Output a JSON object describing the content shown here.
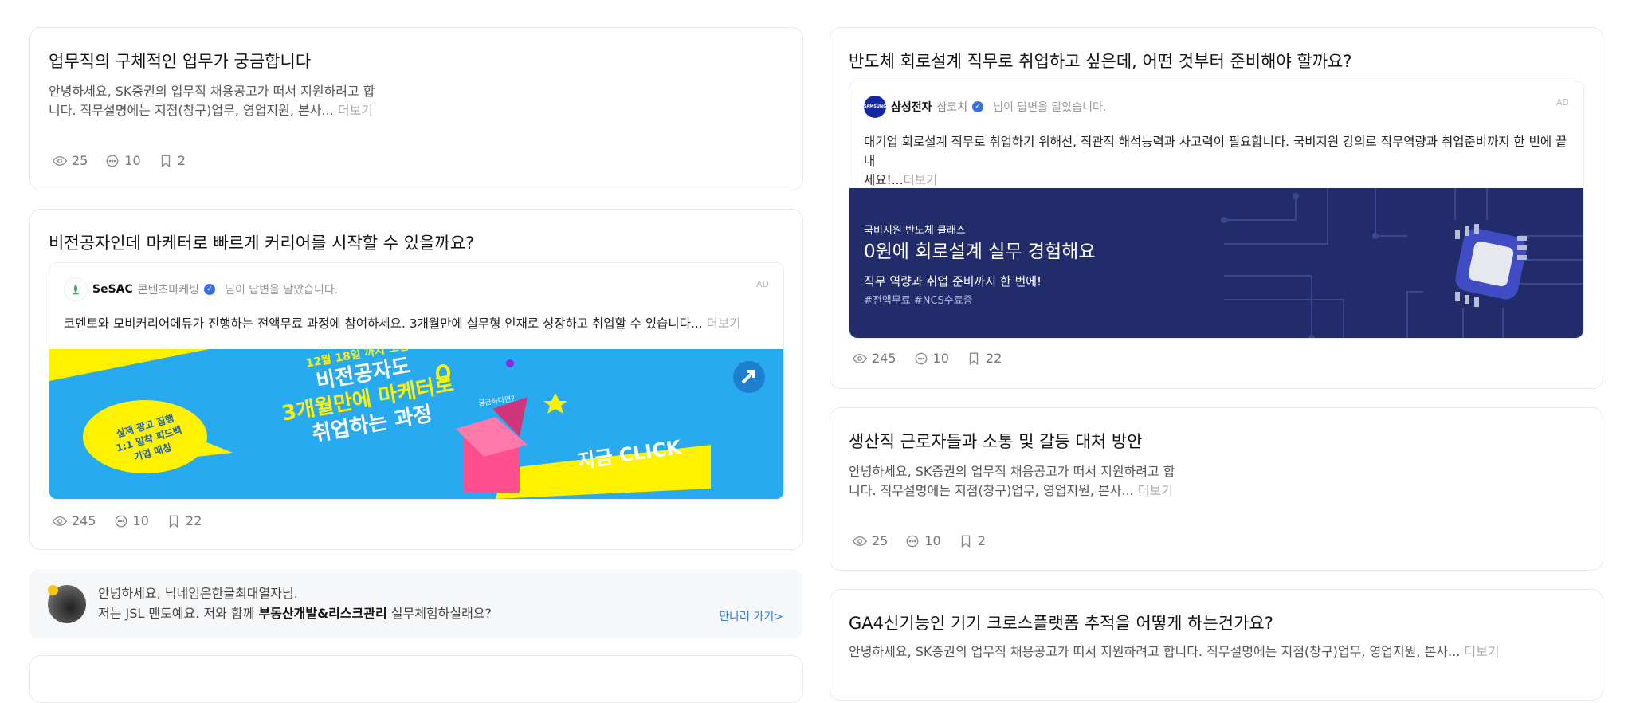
{
  "stats_icons": [
    "eye-icon",
    "comment-icon",
    "bookmark-icon"
  ],
  "cards": {
    "card1": {
      "title": "업무직의 구체적인 업무가 궁금합니다",
      "excerpt_line1": "안녕하세요, SK증권의 업무직 채용공고가 떠서 지원하려고 합",
      "excerpt_line2": "니다. 직무설명에는 지점(창구)업무, 영업지원, 본사...",
      "more": "더보기",
      "views": "25",
      "comments": "10",
      "bookmarks": "2"
    },
    "card2": {
      "title": "비전공자인데 마케터로 빠르게 커리어를 시작할 수 있을까요?",
      "ad": {
        "name": "SeSAC",
        "role": "콘텐츠마케팅",
        "suffix": "님이 답변을 달았습니다.",
        "tag": "AD",
        "text": "코멘토와 모비커리어에듀가 진행하는 전액무료 과정에 참여하세요. 3개월만에 실무형 인재로 성장하고 취업할 수 있습니다...",
        "more": "더보기",
        "banner": {
          "bubble_line1": "실제 광고 집행",
          "bubble_line2": "1:1 밀착 피드백",
          "bubble_line3": "기업 매칭",
          "deadline": "12월 18일 까지 모집!",
          "headline1": "비전공자도",
          "headline2": "3개월만에 마케터로",
          "headline3": "취업하는 과정",
          "curious": "궁금하다면?",
          "cta": "지금 CLICK",
          "bg": "#27aaf0",
          "accent": "#fff200"
        }
      },
      "views": "245",
      "comments": "10",
      "bookmarks": "22"
    },
    "card3": {
      "title": "반도체 회로설계 직무로 취업하고 싶은데, 어떤 것부터 준비해야 할까요?",
      "ad": {
        "name": "삼성전자",
        "role": "삼코치",
        "suffix": "님이 답변을 달았습니다.",
        "tag": "AD",
        "logo_text": "SAMSUNG",
        "text_line1": "대기업 회로설계 직무로 취업하기 위해선, 직관적 해석능력과 사고력이 필요합니다. 국비지원 강의로 직무역량과 취업준비까지 한 번에 끝내",
        "text_line2": "세요!...",
        "more": "더보기",
        "banner": {
          "kicker": "국비지원 반도체 클래스",
          "headline": "0원에 회로설계 실무 경험해요",
          "sub": "직무 역량과 취업 준비까지 한 번에!",
          "tags": "#전액무료 #NCS수료증",
          "bg": "#232c6b"
        }
      },
      "views": "245",
      "comments": "10",
      "bookmarks": "22"
    },
    "card4": {
      "title": "생산직 근로자들과 소통 및 갈등 대처 방안",
      "excerpt_line1": "안녕하세요, SK증권의 업무직 채용공고가 떠서 지원하려고 합",
      "excerpt_line2": "니다. 직무설명에는 지점(창구)업무, 영업지원, 본사...",
      "more": "더보기",
      "views": "25",
      "comments": "10",
      "bookmarks": "2"
    },
    "card5": {
      "title": "GA4신기능인 기기 크로스플랫폼 추적을 어떻게 하는건가요?",
      "excerpt": "안녕하세요, SK증권의 업무직 채용공고가 떠서 지원하려고 합니다. 직무설명에는 지점(창구)업무, 영업지원, 본사...",
      "more": "더보기"
    }
  },
  "mentor": {
    "line1": "안녕하세요, 닉네임은한글최대열자님.",
    "line2_prefix": "저는 JSL 멘토예요. 저와 함께 ",
    "line2_bold": "부동산개발&리스크관리",
    "line2_suffix": " 실무체험하실래요?",
    "link": "만나러 가기>",
    "link_color": "#2b7bd6"
  }
}
